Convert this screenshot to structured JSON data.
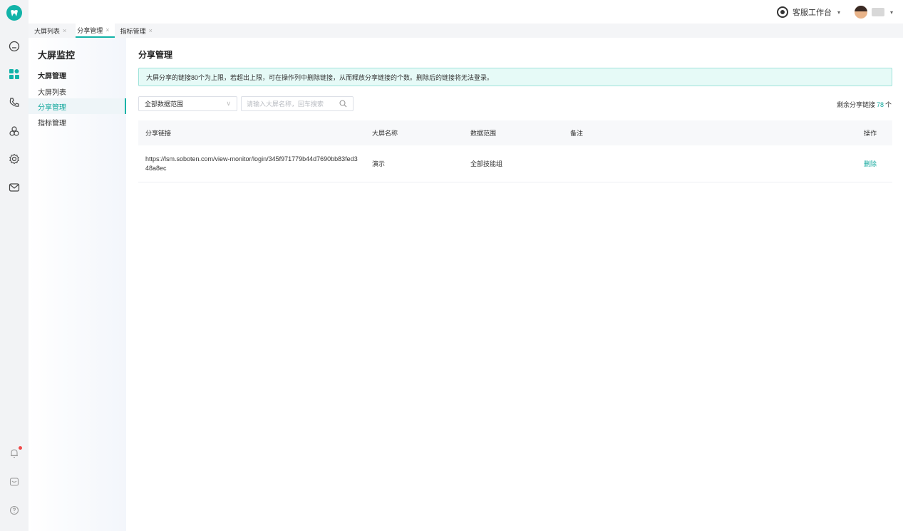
{
  "topbar": {
    "workspace_label": "客服工作台",
    "workspace_caret": "▾",
    "user_caret": "▾"
  },
  "tabs": [
    {
      "label": "大屏列表",
      "close": "×",
      "active": false
    },
    {
      "label": "分享管理",
      "close": "×",
      "active": true
    },
    {
      "label": "指标管理",
      "close": "×",
      "active": false
    }
  ],
  "sidebar": {
    "title": "大屏监控",
    "group": "大屏管理",
    "items": [
      {
        "label": "大屏列表"
      },
      {
        "label": "分享管理"
      },
      {
        "label": "指标管理"
      }
    ]
  },
  "main": {
    "title": "分享管理",
    "notice": "大屏分享的链接80个为上限，若超出上限，可在操作列中删除链接，从而释放分享链接的个数。删除后的链接将无法登录。",
    "filter_value": "全部数据范围",
    "search_placeholder": "请输入大屏名称，回车搜索",
    "remaining_label": "剩余分享链接",
    "remaining_count": "78",
    "remaining_unit": "个"
  },
  "table": {
    "columns": [
      "分享链接",
      "大屏名称",
      "数据范围",
      "备注",
      "操作"
    ],
    "rows": [
      {
        "link": "https://lsm.soboten.com/view-monitor/login/345f971779b44d7690bb83fed348a8ec",
        "name": "演示",
        "scope": "全部技能组",
        "remark": "",
        "action": "删除"
      }
    ]
  },
  "colors": {
    "accent": "#12b3a8",
    "notice_bg": "#e6faf7",
    "rail_bg": "#f2f3f5"
  }
}
